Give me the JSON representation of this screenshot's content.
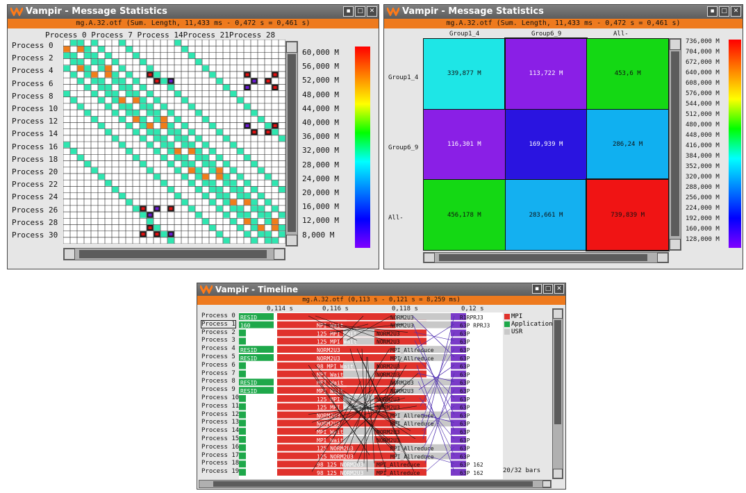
{
  "win1": {
    "title": "Vampir - Message Statistics",
    "subtitle": "mg.A.32.otf (Sum. Length, 11,433 ms - 0,472 s = 0,461 s)",
    "col_header": "Process 0 Process 7 Process 14Process 21Process 28",
    "rows": [
      "Process 0",
      "Process 2",
      "Process 4",
      "Process 6",
      "Process 8",
      "Process 10",
      "Process 12",
      "Process 14",
      "Process 16",
      "Process 18",
      "Process 20",
      "Process 22",
      "Process 24",
      "Process 26",
      "Process 28",
      "Process 30"
    ],
    "legend": [
      "60,000 M",
      "56,000 M",
      "52,000 M",
      "48,000 M",
      "44,000 M",
      "40,000 M",
      "36,000 M",
      "32,000 M",
      "28,000 M",
      "24,000 M",
      "20,000 M",
      "16,000 M",
      "12,000 M",
      "8,000 M"
    ]
  },
  "win2": {
    "title": "Vampir - Message Statistics",
    "subtitle": "mg.A.32.otf (Sum. Length, 11,433 ms - 0,472 s = 0,461 s)",
    "cols": [
      "Group1_4",
      "Group6_9",
      "All-"
    ],
    "rows": [
      "Group1_4",
      "Group6_9",
      "All-"
    ],
    "cells": [
      [
        "339,877 M",
        "113,722 M",
        "453,6 M"
      ],
      [
        "116,301 M",
        "169,939 M",
        "286,24 M"
      ],
      [
        "456,178 M",
        "283,661 M",
        "739,839 M"
      ]
    ],
    "cell_colors": [
      [
        "#1ee6e6",
        "#8a1fe6",
        "#14d814"
      ],
      [
        "#8a1fe6",
        "#2a14e0",
        "#10b0f0"
      ],
      [
        "#14d814",
        "#14b0f0",
        "#f01414"
      ]
    ],
    "legend": [
      "736,000 M",
      "704,000 M",
      "672,000 M",
      "640,000 M",
      "608,000 M",
      "576,000 M",
      "544,000 M",
      "512,000 M",
      "480,000 M",
      "448,000 M",
      "416,000 M",
      "384,000 M",
      "352,000 M",
      "320,000 M",
      "288,000 M",
      "256,000 M",
      "224,000 M",
      "192,000 M",
      "160,000 M",
      "128,000 M"
    ]
  },
  "win3": {
    "title": "Vampir - Timeline",
    "subtitle": "mg.A.32.otf (0,113 s - 0,121 s = 8,259 ms)",
    "ticks": [
      "0,114 s",
      "0,116 s",
      "0,118 s",
      "0,12 s"
    ],
    "processes": [
      "Process 0",
      "Process 1",
      "Process 2",
      "Process 3",
      "Process 4",
      "Process 5",
      "Process 6",
      "Process 7",
      "Process 8",
      "Process 9",
      "Process 10",
      "Process 11",
      "Process 12",
      "Process 13",
      "Process 14",
      "Process 15",
      "Process 16",
      "Process 17",
      "Process 18",
      "Process 19"
    ],
    "legend": [
      {
        "label": "MPI",
        "color": "#e0322c"
      },
      {
        "label": "Application",
        "color": "#1ea84a"
      },
      {
        "label": "USR",
        "color": "#c8c8c8"
      }
    ],
    "bars_status": "20/32 bars",
    "row_labels": [
      {
        "a": "RESID",
        "b": "",
        "c": "NORM2U3",
        "d": "R1RPRJ3"
      },
      {
        "a": "160",
        "b": "MPI_Wait",
        "c": "NORM2U3",
        "d": "63P RPRJ3"
      },
      {
        "a": "",
        "b": "125 MPI_Wait",
        "c": "NORM2U3",
        "d": "63P"
      },
      {
        "a": "",
        "b": "125 MPI_Wait",
        "c": "NORM2U3",
        "d": "63P"
      },
      {
        "a": "RESID",
        "b": "NORM2U3",
        "c": "MPI_Allreduce",
        "d": "63P"
      },
      {
        "a": "RESID",
        "b": "NORM2U3",
        "c": "MPI_Allreduce",
        "d": "63P"
      },
      {
        "a": "",
        "b": "98 MPI_Wait",
        "c": "NORM2U3",
        "d": "63P"
      },
      {
        "a": "",
        "b": "MPI_Wait",
        "c": "NORM2U3",
        "d": "63P"
      },
      {
        "a": "RESID",
        "b": "MPI_Wait",
        "c": "NORM2U3",
        "d": "63P"
      },
      {
        "a": "RESID",
        "b": "MPI_Wait",
        "c": "NORM2U3",
        "d": "63P"
      },
      {
        "a": "",
        "b": "125 MPI_Wait",
        "c": "NORM2U3",
        "d": "63P"
      },
      {
        "a": "",
        "b": "125 MPI_Wait",
        "c": "NORM2U3",
        "d": "63P"
      },
      {
        "a": "",
        "b": "NORM2U3",
        "c": "MPI_Allreduce",
        "d": "63P"
      },
      {
        "a": "",
        "b": "NORM2U3",
        "c": "MPI_Allreduce",
        "d": "63P"
      },
      {
        "a": "",
        "b": "MPI_Wait",
        "c": "NORM2U3",
        "d": "63P"
      },
      {
        "a": "",
        "b": "MPI_Wait",
        "c": "NORM2U3",
        "d": "63P"
      },
      {
        "a": "",
        "b": "125 NORM2U3",
        "c": "MPI_Allreduce",
        "d": "63P"
      },
      {
        "a": "",
        "b": "125 NORM2U3",
        "c": "MPI_Allreduce",
        "d": "63P"
      },
      {
        "a": "",
        "b": "98 125 NORM2U3",
        "c": "MPI_Allreduce",
        "d": "63P 162"
      },
      {
        "a": "",
        "b": "98 125 NORM2U3",
        "c": "MPI_Allreduce",
        "d": "63P 162"
      }
    ]
  }
}
